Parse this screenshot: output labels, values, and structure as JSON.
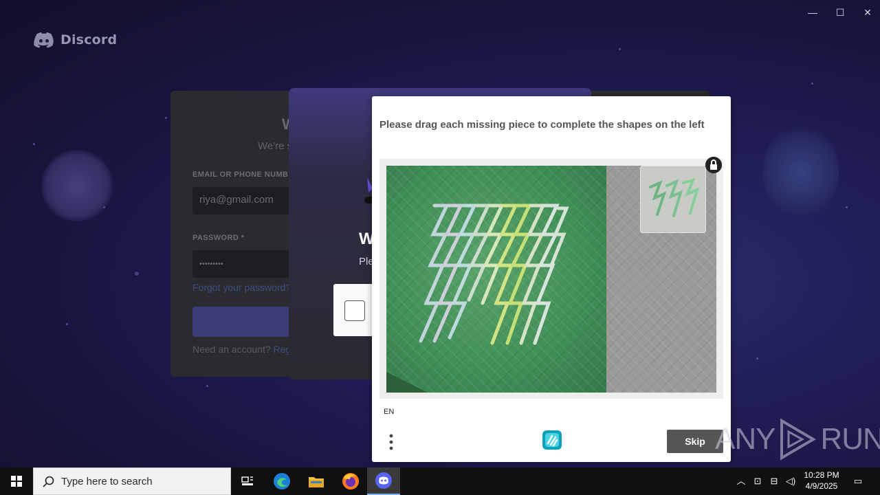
{
  "window": {
    "minimize": "—",
    "maximize": "☐",
    "close": "✕"
  },
  "brand": {
    "name": "Discord"
  },
  "login": {
    "title": "W",
    "subtitle": "We're s",
    "email_label": "EMAIL OR PHONE NUMB",
    "email_value": "riya@gmail.com",
    "password_label": "PASSWORD *",
    "password_value": "•••••••••",
    "forgot": "Forgot your password?",
    "need_account": "Need an account?",
    "register": "Regis"
  },
  "hcaptcha_modal": {
    "title": "W",
    "subtitle": "Ple"
  },
  "challenge": {
    "prompt": "Please drag each missing piece to complete the shapes on the left",
    "language": "EN",
    "skip_label": "Skip"
  },
  "watermark": {
    "text_left": "ANY",
    "text_right": "RUN"
  },
  "taskbar": {
    "search_placeholder": "Type here to search",
    "time": "10:28 PM",
    "date": "4/9/2025"
  },
  "colors": {
    "accent": "#5865f2",
    "taskbar": "#101010",
    "skip_button": "#555555"
  }
}
